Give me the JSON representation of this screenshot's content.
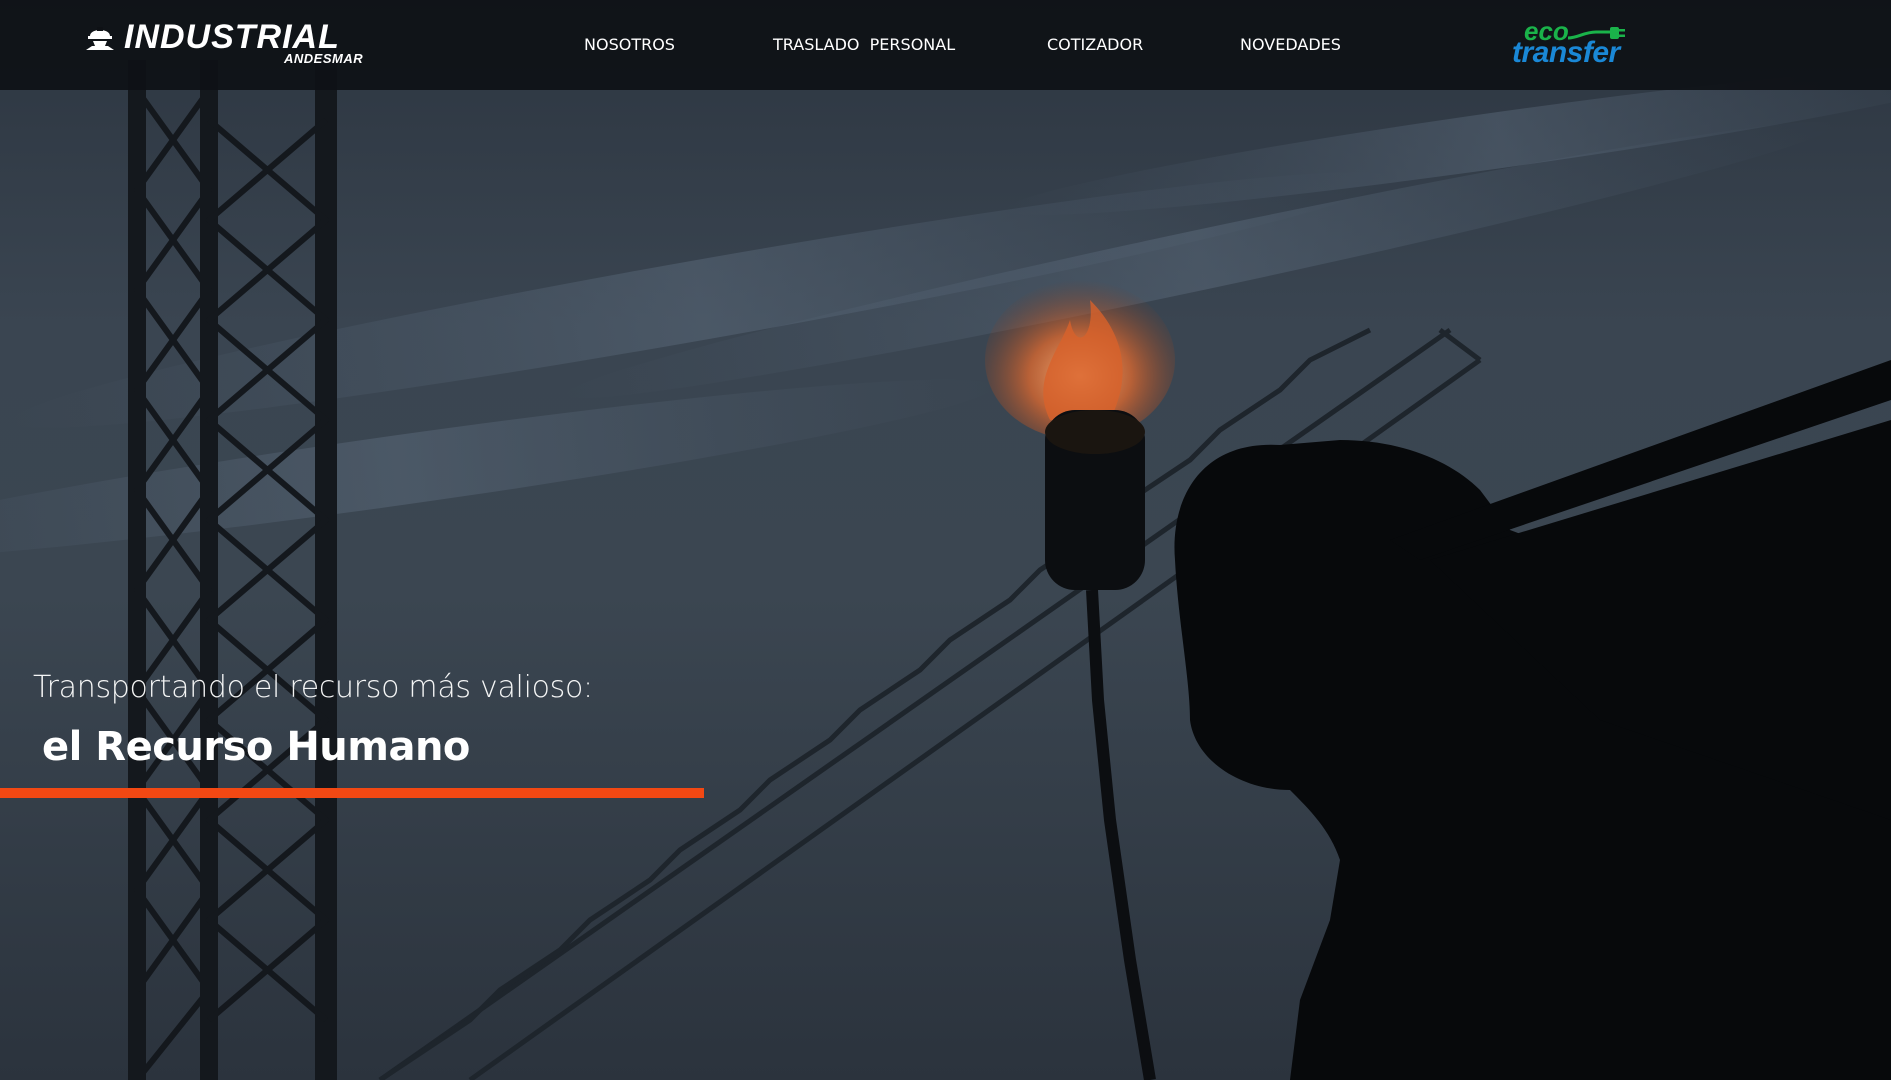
{
  "brand": {
    "name": "INDUSTRIAL",
    "subtitle": "ANDESMAR",
    "icon": "worker-helmet-icon"
  },
  "nav": {
    "items": [
      {
        "label": "NOSOTROS"
      },
      {
        "label": "TRASLADO  PERSONAL"
      },
      {
        "label": "COTIZADOR"
      },
      {
        "label": "NOVEDADES"
      }
    ]
  },
  "partner_logo": {
    "top_text": "eco",
    "bottom_text": "transfer",
    "icon": "plug-icon",
    "colors": {
      "top": "#1ab34a",
      "bottom": "#1a88d6"
    }
  },
  "hero": {
    "tagline": "Transportando el recurso más valioso:",
    "headline": "el Recurso Humano",
    "accent_color": "#f24813"
  }
}
